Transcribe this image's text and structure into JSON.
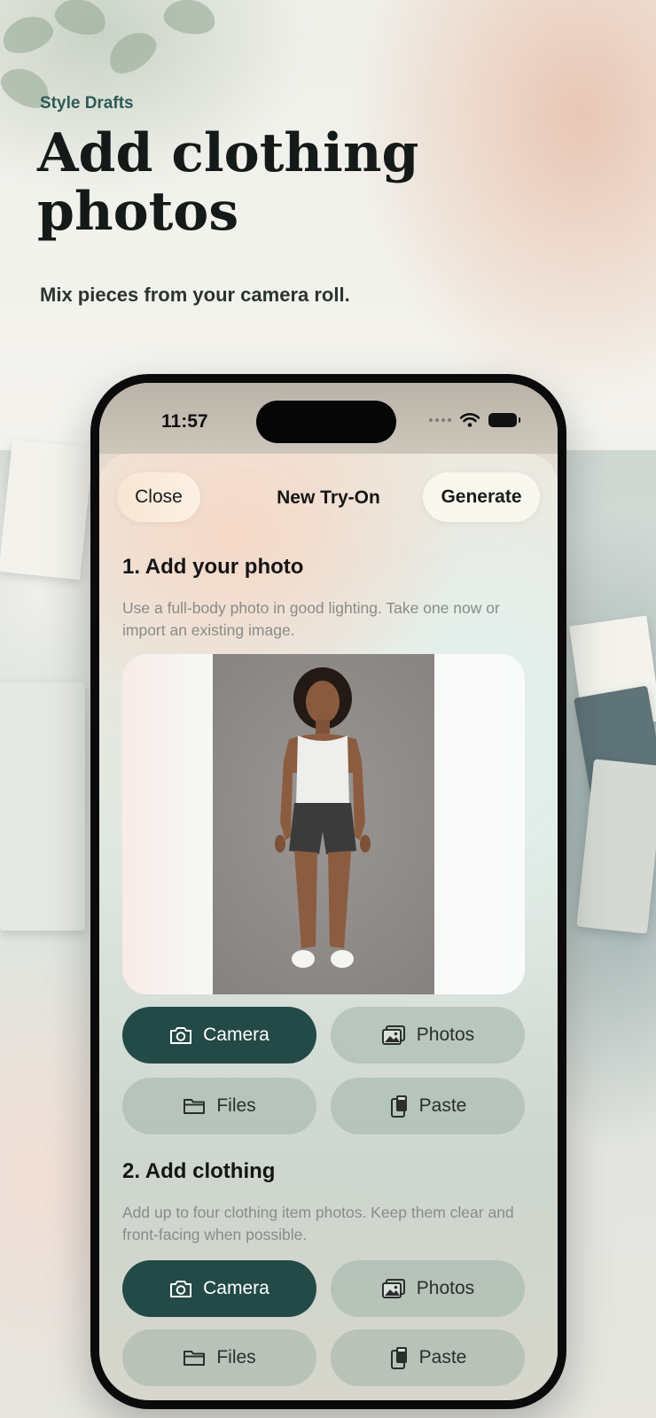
{
  "hero": {
    "kicker": "Style Drafts",
    "title": "Add clothing photos",
    "subtitle": "Mix pieces from your camera roll."
  },
  "status_bar": {
    "time": "11:57"
  },
  "nav": {
    "close_label": "Close",
    "title": "New Try-On",
    "generate_label": "Generate"
  },
  "section_photo": {
    "title": "1. Add your photo",
    "description": "Use a full-body photo in good lighting. Take one now or import an existing image.",
    "buttons": [
      {
        "label": "Camera",
        "icon": "camera-icon"
      },
      {
        "label": "Photos",
        "icon": "photos-icon"
      },
      {
        "label": "Files",
        "icon": "folder-icon"
      },
      {
        "label": "Paste",
        "icon": "paste-icon"
      }
    ]
  },
  "section_clothing": {
    "title": "2. Add clothing",
    "description": "Add up to four clothing item photos. Keep them clear and front-facing when possible.",
    "buttons": [
      {
        "label": "Camera",
        "icon": "camera-icon"
      },
      {
        "label": "Photos",
        "icon": "photos-icon"
      },
      {
        "label": "Files",
        "icon": "folder-icon"
      },
      {
        "label": "Paste",
        "icon": "paste-icon"
      }
    ]
  },
  "colors": {
    "accent": "#234a47",
    "kicker": "#2d5a55",
    "secondary_button": "#a0b2aa"
  }
}
